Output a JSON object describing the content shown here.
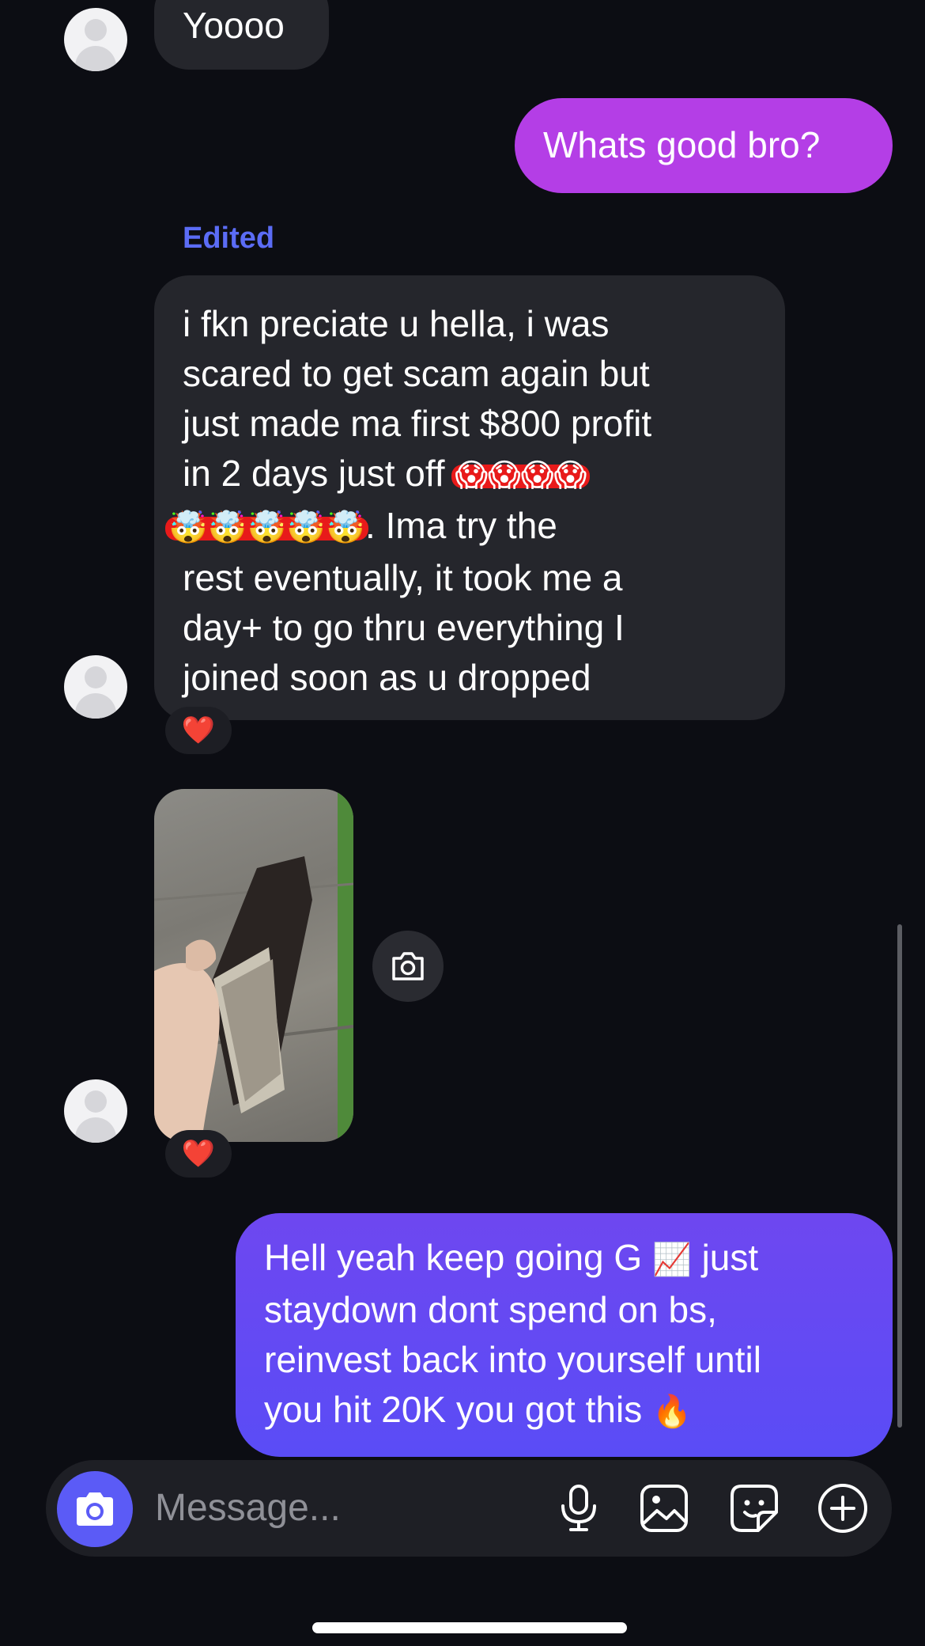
{
  "conversation": {
    "messages": [
      {
        "type": "received",
        "text": "Yoooo"
      },
      {
        "type": "sent",
        "text": "Whats good bro?"
      },
      {
        "type": "received",
        "edited_label": "Edited",
        "line1": "i fkn preciate u hella, i was",
        "line2": "scared to get scam again but",
        "line3": "just made ma first $800 profit",
        "line4": "in 2 days just off",
        "line4_emojis": "😱😱😱😱",
        "line5_emojis": "🤯🤯🤯🤯🤯",
        "line5": ". Ima try the",
        "line6": "rest eventually, it took me a",
        "line7": "day+ to go thru everything I",
        "line8": "joined soon as u dropped",
        "reaction": "❤️"
      },
      {
        "type": "received-photo",
        "reaction": "❤️"
      },
      {
        "type": "sent",
        "line1": "Hell yeah keep going G",
        "line1_emoji": "📈",
        "line1_end": "just",
        "line2": "staydown dont spend on bs,",
        "line3": "reinvest back into yourself until",
        "line4": "you hit 20K you got this",
        "line4_emoji": "🔥"
      }
    ]
  },
  "composer": {
    "placeholder": "Message...",
    "icons": [
      "camera-icon",
      "microphone-icon",
      "gallery-icon",
      "sticker-icon",
      "plus-circle-icon"
    ]
  },
  "colors": {
    "background": "#0c0d13",
    "received_bubble": "#25262c",
    "sent_gradient_top": "#b43ee6",
    "sent_gradient_bottom": "#5a4cf6",
    "accent": "#5b5bf6",
    "edited_label": "#5b6cf5"
  }
}
